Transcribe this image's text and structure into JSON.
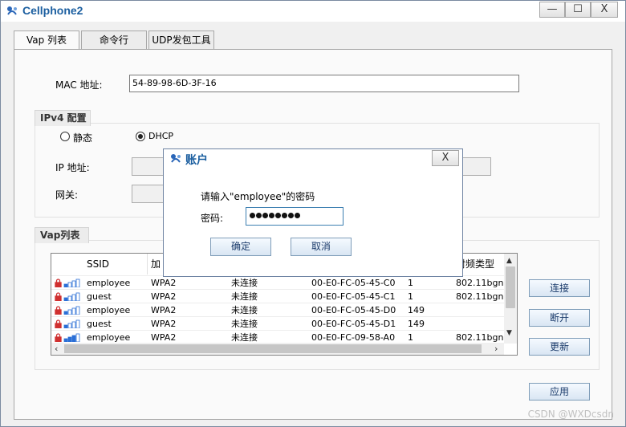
{
  "window": {
    "title": "Cellphone2",
    "minimize": "—",
    "maximize": "☐",
    "close": "X"
  },
  "tabs": [
    {
      "label": "Vap 列表"
    },
    {
      "label": "命令行"
    },
    {
      "label": "UDP发包工具"
    }
  ],
  "mac": {
    "label": "MAC 地址:",
    "value": "54-89-98-6D-3F-16"
  },
  "ipv4": {
    "title": "IPv4 配置",
    "static_label": "静态",
    "dhcp_label": "DHCP",
    "ip_label": "IP 地址:",
    "gateway_label": "网关:"
  },
  "vap": {
    "title": "Vap列表",
    "columns": [
      "SSID",
      "加",
      "",
      "",
      "",
      "射频类型"
    ],
    "rows": [
      {
        "ssid": "employee",
        "security": "WPA2",
        "status": "未连接",
        "bssid": "00-E0-FC-05-45-C0",
        "channel": "1",
        "radio": "802.11bgn",
        "bars": 1
      },
      {
        "ssid": "guest",
        "security": "WPA2",
        "status": "未连接",
        "bssid": "00-E0-FC-05-45-C1",
        "channel": "1",
        "radio": "802.11bgn",
        "bars": 1
      },
      {
        "ssid": "employee",
        "security": "WPA2",
        "status": "未连接",
        "bssid": "00-E0-FC-05-45-D0",
        "channel": "149",
        "radio": "",
        "bars": 1
      },
      {
        "ssid": "guest",
        "security": "WPA2",
        "status": "未连接",
        "bssid": "00-E0-FC-05-45-D1",
        "channel": "149",
        "radio": "",
        "bars": 1
      },
      {
        "ssid": "employee",
        "security": "WPA2",
        "status": "未连接",
        "bssid": "00-E0-FC-09-58-A0",
        "channel": "1",
        "radio": "802.11bgn",
        "bars": 3
      }
    ],
    "connect": "连接",
    "disconnect": "断开",
    "refresh": "更新"
  },
  "apply": "应用",
  "dialog": {
    "title": "账户",
    "close": "X",
    "prompt": "请输入\"employee\"的密码",
    "password_label": "密码:",
    "password_length": 8,
    "ok": "确定",
    "cancel": "取消"
  },
  "watermark": "CSDN @WXDcsdn",
  "colors": {
    "title": "#1c5fa0",
    "signal": "#2b6fd6",
    "lock": "#d03030"
  }
}
